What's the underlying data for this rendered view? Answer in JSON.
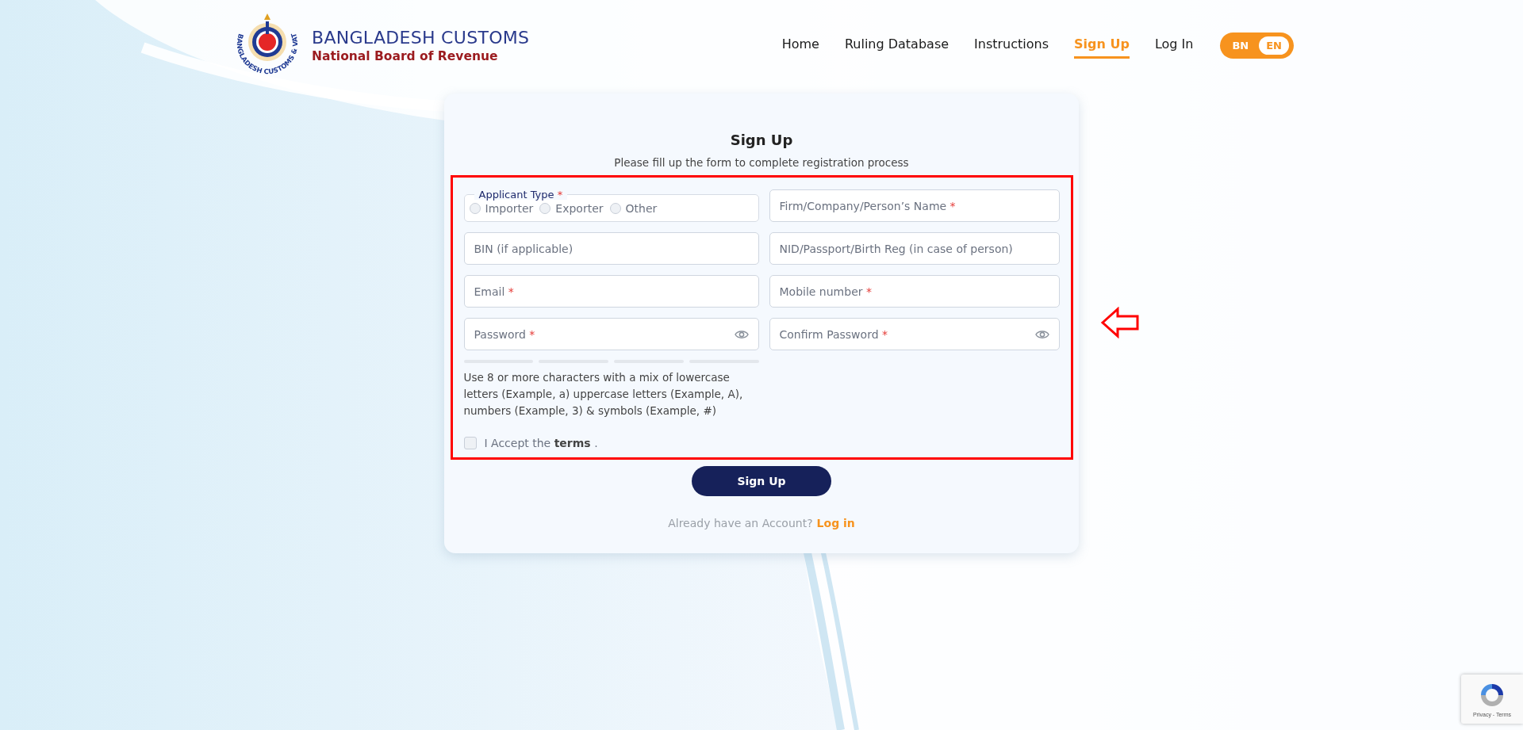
{
  "logo": {
    "title": "BANGLADESH CUSTOMS",
    "subtitle": "National Board of Revenue",
    "emblem_text": "BANGLADESH CUSTOMS & VAT"
  },
  "nav": [
    {
      "label": "Home",
      "selected": false
    },
    {
      "label": "Ruling Database",
      "selected": false
    },
    {
      "label": "Instructions",
      "selected": false
    },
    {
      "label": "Sign Up",
      "selected": true
    },
    {
      "label": "Log In",
      "selected": false
    }
  ],
  "language": [
    {
      "label": "BN",
      "selected": false
    },
    {
      "label": "EN",
      "selected": true
    }
  ],
  "form": {
    "title": "Sign Up",
    "subtitle": "Please fill up the form to complete registration process",
    "applicant_type": {
      "label": "Applicant Type",
      "required_mark": "*",
      "options": [
        {
          "label": "Importer",
          "selected": false
        },
        {
          "label": "Exporter",
          "selected": false
        },
        {
          "label": "Other",
          "selected": false
        }
      ]
    },
    "fields": [
      {
        "kind": "text",
        "placeholder": "Firm/Company/Person’s Name",
        "required_mark": "*"
      },
      {
        "kind": "text",
        "placeholder": "BIN (if applicable)"
      },
      {
        "kind": "text",
        "placeholder": "NID/Passport/Birth Reg (in case of person)"
      },
      {
        "kind": "text",
        "placeholder": "Email",
        "required_mark": "*"
      },
      {
        "kind": "text",
        "placeholder": "Mobile number",
        "required_mark": "*"
      },
      {
        "kind": "password",
        "placeholder": "Password",
        "required_mark": "*"
      },
      {
        "kind": "password",
        "placeholder": "Confirm Password",
        "required_mark": "*"
      }
    ],
    "password_hint": "Use 8 or more characters with a mix of lowercase letters (Example, a) uppercase letters (Example, A), numbers (Example, 3) & symbols (Example, #)",
    "terms": {
      "text": "I Accept the **terms** .",
      "checked": false
    },
    "submit": "Sign Up",
    "footer": {
      "text": "Already have an Account?",
      "link": "Log in"
    }
  },
  "recaptcha": {
    "text": "Privacy - Terms"
  }
}
